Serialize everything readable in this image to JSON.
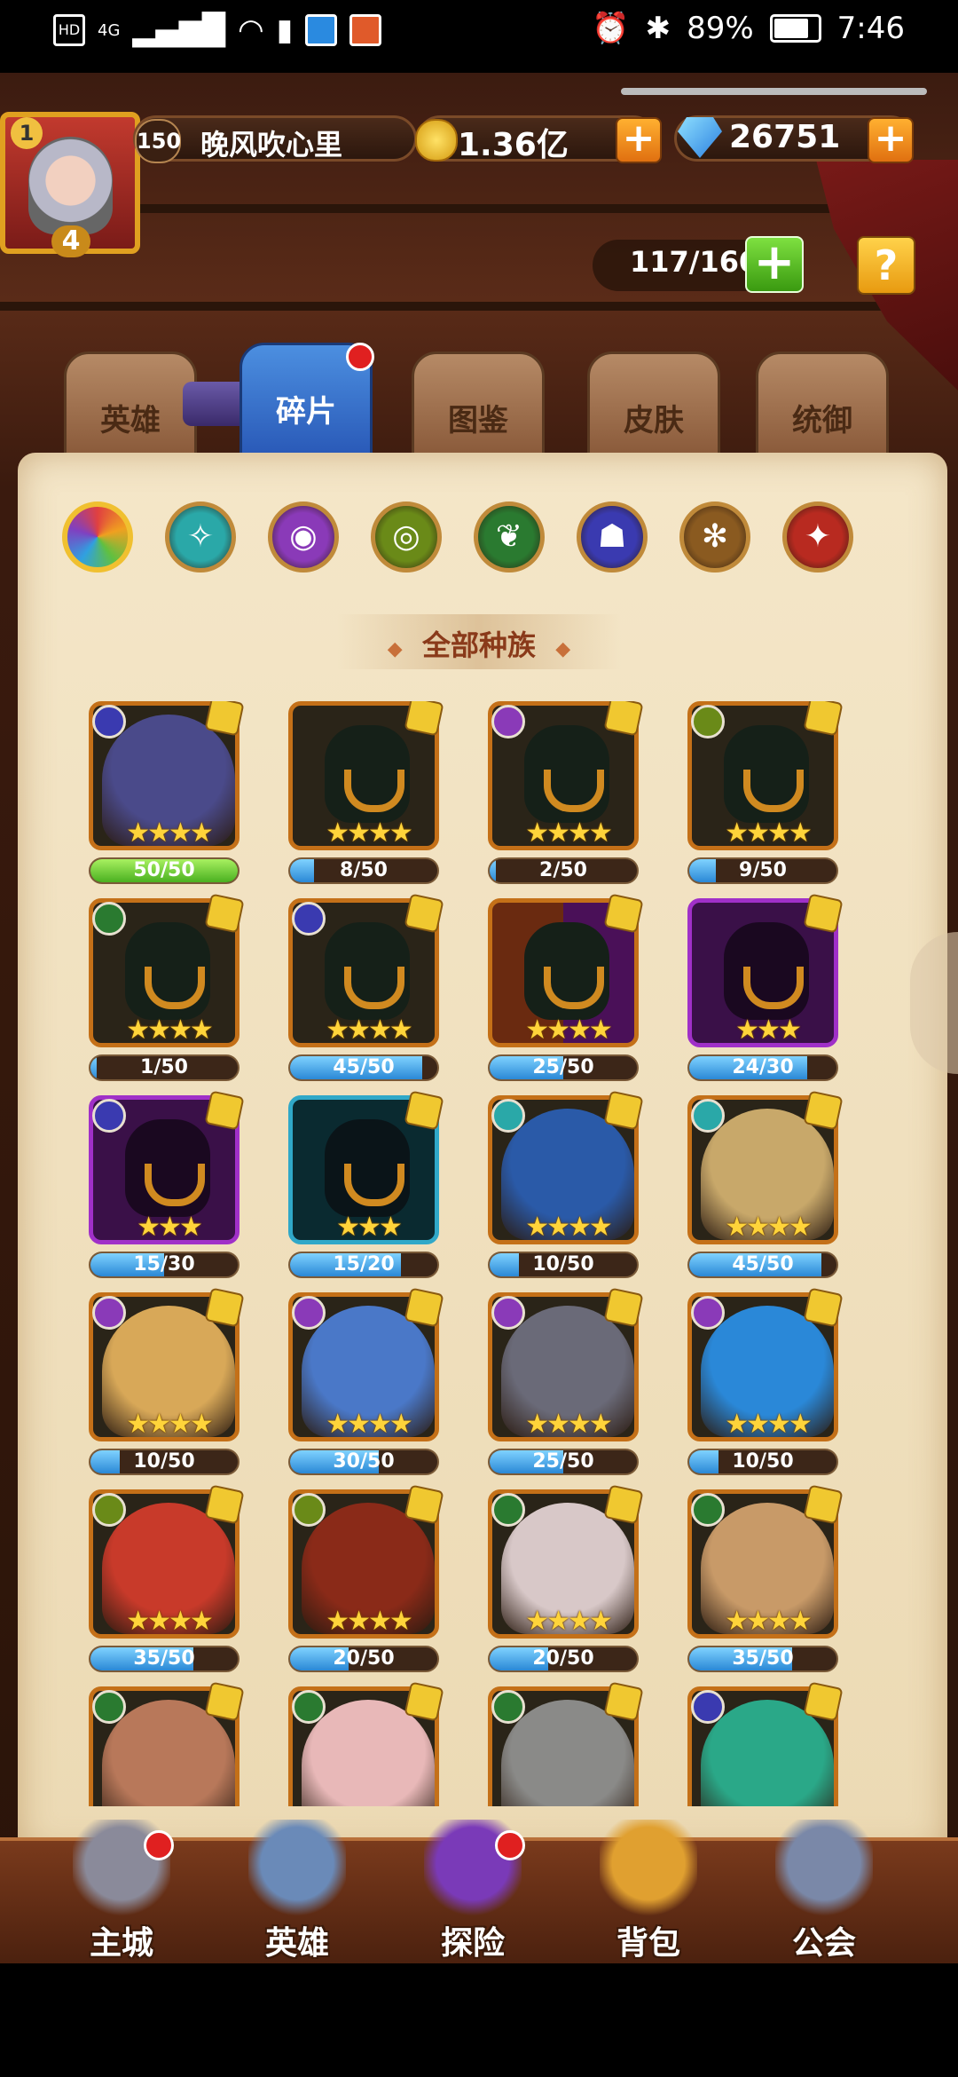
{
  "status_bar": {
    "left_icons": [
      "HD",
      "4G",
      "signal-icon",
      "wifi-icon",
      "alert-icon",
      "app-icon",
      "app-icon-2"
    ],
    "battery_percent": "89%",
    "time": "7:46"
  },
  "player": {
    "rank": "1",
    "avatar_level": "4",
    "level": "150",
    "name": "晚风吹心里"
  },
  "currency": {
    "gold": "1.36亿",
    "gems": "26751"
  },
  "capacity": {
    "text": "117/160"
  },
  "help": {
    "label": "?"
  },
  "tabs": [
    {
      "label": "英雄",
      "active": false
    },
    {
      "label": "碎片",
      "active": true
    },
    {
      "label": "图鉴",
      "active": false
    },
    {
      "label": "皮肤",
      "active": false
    },
    {
      "label": "统御",
      "active": false
    }
  ],
  "race_filters": [
    {
      "name": "all",
      "color": "#e04040"
    },
    {
      "name": "nature",
      "color": "#2aa8a8"
    },
    {
      "name": "arcane",
      "color": "#8a3ab8"
    },
    {
      "name": "eye",
      "color": "#6a8a18"
    },
    {
      "name": "leaf",
      "color": "#2a7a30"
    },
    {
      "name": "demon",
      "color": "#3a3ab0"
    },
    {
      "name": "wheel",
      "color": "#8a5a20"
    },
    {
      "name": "fire",
      "color": "#b82a20"
    }
  ],
  "section_title": "全部种族",
  "cards": [
    {
      "progress": "50/50",
      "value": 1.0,
      "stars": "★★★★",
      "type": "portrait",
      "color": "#4a4a8a",
      "race": "#3a3ab0"
    },
    {
      "progress": "8/50",
      "value": 0.16,
      "stars": "★★★★",
      "type": "silhouette",
      "race": ""
    },
    {
      "progress": "2/50",
      "value": 0.04,
      "stars": "★★★★",
      "type": "silhouette",
      "race": "#8a3ab8"
    },
    {
      "progress": "9/50",
      "value": 0.18,
      "stars": "★★★★",
      "type": "silhouette",
      "race": "#6a8a18"
    },
    {
      "progress": "1/50",
      "value": 0.02,
      "stars": "★★★★",
      "type": "silhouette",
      "race": "#2a7a30"
    },
    {
      "progress": "45/50",
      "value": 0.9,
      "stars": "★★★★",
      "type": "silhouette",
      "race": "#3a3ab0"
    },
    {
      "progress": "25/50",
      "value": 0.5,
      "stars": "★★★★",
      "type": "silhouette-red",
      "race": ""
    },
    {
      "progress": "24/30",
      "value": 0.8,
      "stars": "★★★",
      "type": "silhouette-purple",
      "race": ""
    },
    {
      "progress": "15/30",
      "value": 0.5,
      "stars": "★★★",
      "type": "silhouette-purple",
      "race": "#3a3ab0"
    },
    {
      "progress": "15/20",
      "value": 0.75,
      "stars": "★★★",
      "type": "silhouette-cyan",
      "race": ""
    },
    {
      "progress": "10/50",
      "value": 0.2,
      "stars": "★★★★",
      "type": "portrait",
      "color": "#2a5aa8",
      "race": "#2aa8a8"
    },
    {
      "progress": "45/50",
      "value": 0.9,
      "stars": "★★★★",
      "type": "portrait",
      "color": "#c8a86a",
      "race": "#2aa8a8"
    },
    {
      "progress": "10/50",
      "value": 0.2,
      "stars": "★★★★",
      "type": "portrait",
      "color": "#d8a858",
      "race": "#8a3ab8"
    },
    {
      "progress": "30/50",
      "value": 0.6,
      "stars": "★★★★",
      "type": "portrait",
      "color": "#4a78c8",
      "race": "#8a3ab8"
    },
    {
      "progress": "25/50",
      "value": 0.5,
      "stars": "★★★★",
      "type": "portrait",
      "color": "#6a6a78",
      "race": "#8a3ab8"
    },
    {
      "progress": "10/50",
      "value": 0.2,
      "stars": "★★★★",
      "type": "portrait",
      "color": "#2a88d8",
      "race": "#8a3ab8"
    },
    {
      "progress": "35/50",
      "value": 0.7,
      "stars": "★★★★",
      "type": "portrait",
      "color": "#c83a2a",
      "race": "#6a8a18"
    },
    {
      "progress": "20/50",
      "value": 0.4,
      "stars": "★★★★",
      "type": "portrait",
      "color": "#8a2a18",
      "race": "#6a8a18"
    },
    {
      "progress": "20/50",
      "value": 0.4,
      "stars": "★★★★",
      "type": "portrait",
      "color": "#d8c8c8",
      "race": "#2a7a30"
    },
    {
      "progress": "35/50",
      "value": 0.7,
      "stars": "★★★★",
      "type": "portrait",
      "color": "#c89a68",
      "race": "#2a7a30"
    },
    {
      "progress": "",
      "value": 0,
      "stars": "",
      "type": "portrait",
      "color": "#b8785a",
      "race": "#2a7a30"
    },
    {
      "progress": "",
      "value": 0,
      "stars": "",
      "type": "portrait",
      "color": "#e8b8b8",
      "race": "#2a7a30"
    },
    {
      "progress": "",
      "value": 0,
      "stars": "",
      "type": "portrait",
      "color": "#8a8a88",
      "race": "#2a7a30"
    },
    {
      "progress": "",
      "value": 0,
      "stars": "",
      "type": "portrait",
      "color": "#2aa888",
      "race": "#3a3ab0"
    }
  ],
  "bottom_nav": [
    {
      "label": "主城",
      "dot": true,
      "color": "#8a8a9a"
    },
    {
      "label": "英雄",
      "dot": false,
      "color": "#6a8ab8"
    },
    {
      "label": "探险",
      "dot": true,
      "color": "#7a3ab8"
    },
    {
      "label": "背包",
      "dot": false,
      "color": "#e0a030"
    },
    {
      "label": "公会",
      "dot": false,
      "color": "#7a88a8"
    }
  ]
}
